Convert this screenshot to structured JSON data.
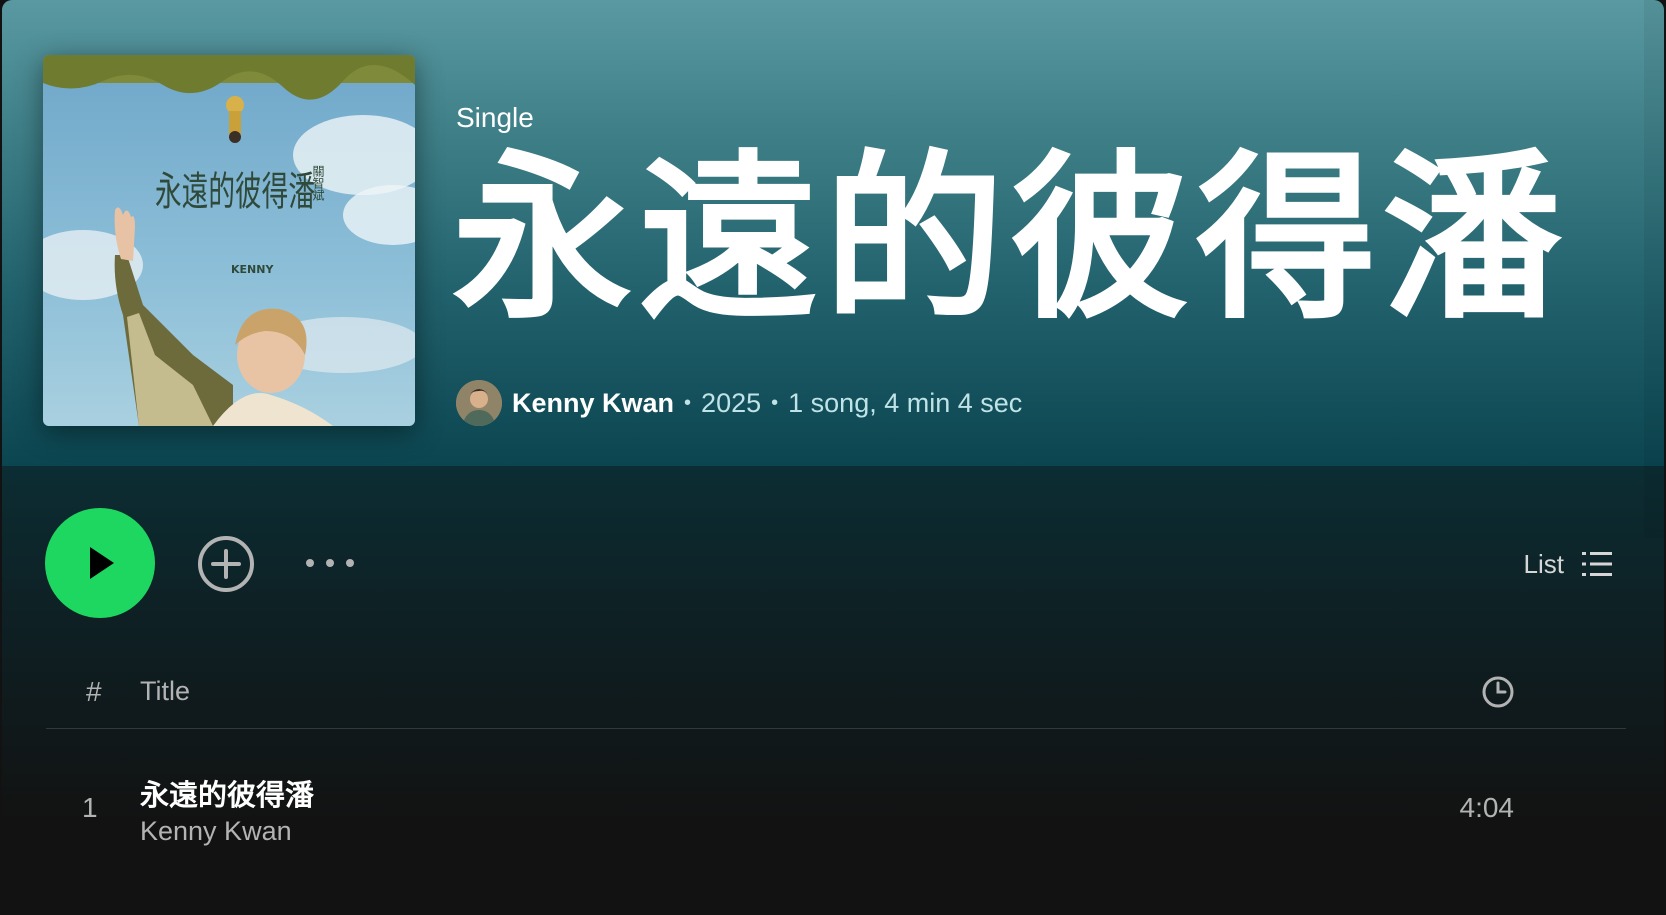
{
  "header": {
    "type_label": "Single",
    "title": "永遠的彼得潘",
    "artist": "Kenny Kwan",
    "year": "2025",
    "summary": "1 song, 4 min 4 sec",
    "separator": "•"
  },
  "cover": {
    "text_main": "永遠的彼得潘",
    "text_side": "關智斌",
    "text_brand": "KENNY"
  },
  "actions": {
    "play_icon": "play-icon",
    "add_icon": "plus-circle-icon",
    "more_icon": "more-horizontal-icon",
    "view_label": "List",
    "view_icon": "list-icon"
  },
  "table": {
    "columns": {
      "number": "#",
      "title": "Title",
      "duration_icon": "clock-icon"
    },
    "tracks": [
      {
        "number": "1",
        "title": "永遠的彼得潘",
        "artist": "Kenny Kwan",
        "duration": "4:04"
      }
    ]
  },
  "colors": {
    "accent": "#1ed760",
    "hero_top": "#5a99a2",
    "hero_bottom": "#0b4550",
    "background": "#121212"
  }
}
